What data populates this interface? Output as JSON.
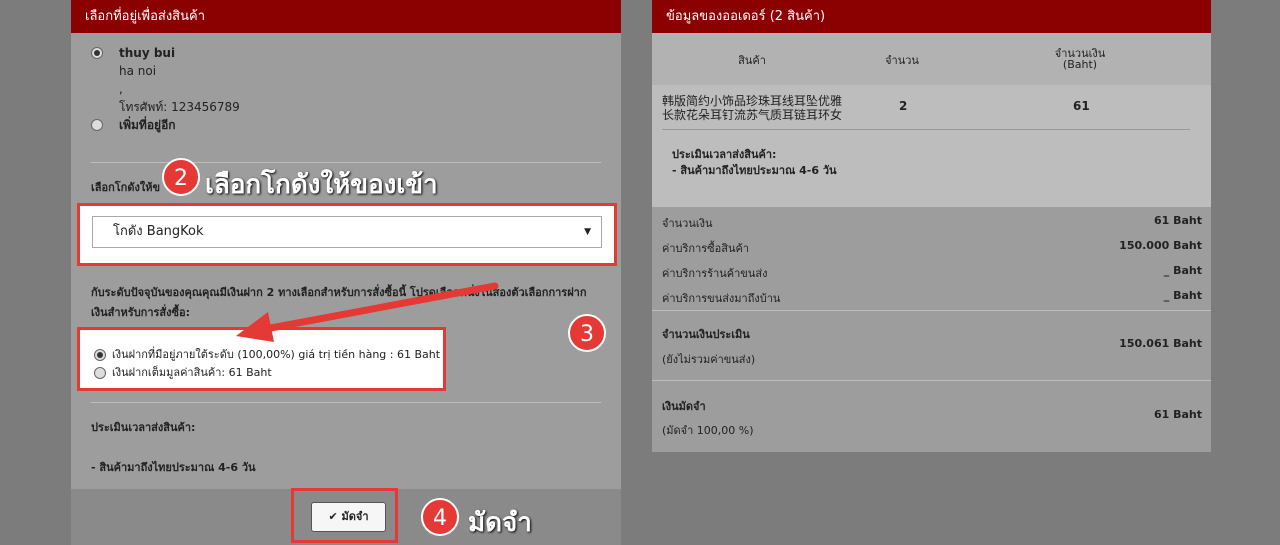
{
  "left_panel": {
    "title": "เลือกที่อยู่เพื่อส่งสินค้า",
    "address": {
      "name": "thuy bui",
      "city": "ha noi",
      "extra": ",",
      "phone": "โทรศัพท์: 123456789"
    },
    "add_address_label": "เพิ่มที่อยู่อีก",
    "warehouse_label": "เลือกโกดังให้ข",
    "warehouse_value": "โกดัง BangKok",
    "deposit_text": "กับระดับปัจจุบันของคุณคุณมีเงินฝาก 2 ทางเลือกสำหรับการสั่งซื้อนี้ โปรดเลือกหนึ่งในสองตัวเลือกการฝากเงินสำหรับการสั่งซื้อ:",
    "option1": "เงินฝากที่มีอยู่ภายใต้ระดับ (100,00%) giá trị tiền hàng : 61 Baht",
    "option2": "เงินฝากเต็มมูลค่าสินค้า: 61 Baht",
    "shipping_estimate_label": "ประเมินเวลาส่งสินค้า:",
    "shipping_estimate_value": "- สินค้ามาถึงไทยประมาณ 4-6 วัน",
    "deposit_button": "มัดจำ"
  },
  "callouts": {
    "c2_num": "2",
    "c2_text": "เลือกโกดังให้ของเข้า",
    "c3_num": "3",
    "c4_num": "4",
    "c4_text": "มัดจำ"
  },
  "right_panel": {
    "title": "ข้อมูลของออเดอร์ (2 สินค้า)",
    "columns": {
      "product": "สินค้า",
      "qty": "จำนวน",
      "amount_line1": "จำนวนเงิน",
      "amount_line2": "(Baht)"
    },
    "item": {
      "name_line1": "韩版简约小饰品珍珠耳线耳坠优雅",
      "name_line2": "长款花朵耳钉流苏气质耳链耳环女",
      "qty": "2",
      "amount": "61"
    },
    "item_estimate_label": "ประเมินเวลาส่งสินค้า:",
    "item_estimate_value": "- สินค้ามาถึงไทยประมาณ 4-6 วัน",
    "summary": [
      {
        "label": "จำนวนเงิน",
        "value": "61 Baht"
      },
      {
        "label": "ค่าบริการซื้อสินค้า",
        "value": "150.000 Baht"
      },
      {
        "label": "ค่าบริการร้านค้าขนส่ง",
        "value": "_ Baht"
      },
      {
        "label": "ค่าบริการขนส่งมาถึงบ้าน",
        "value": "_ Baht"
      }
    ],
    "estimate_total_label": "จำนวนเงินประเมิน",
    "estimate_total_note": "(ยังไม่รวมค่าขนส่ง)",
    "estimate_total_value": "150.061 Baht",
    "deposit_label": "เงินมัดจำ",
    "deposit_note": "(มัดจำ 100,00 %)",
    "deposit_value": "61 Baht"
  },
  "colors": {
    "header": "#8b0000",
    "callout": "#e53935"
  }
}
